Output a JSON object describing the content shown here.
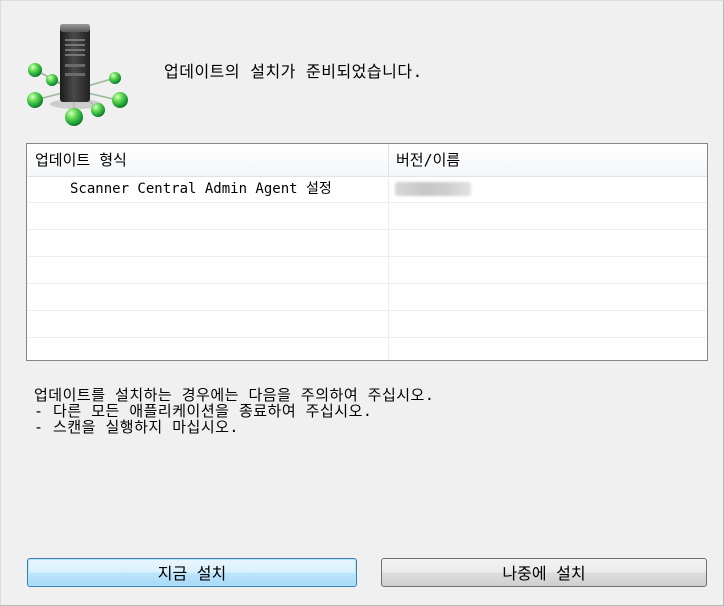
{
  "dialog": {
    "header_text": "업데이트의 설치가 준비되었습니다."
  },
  "update_list": {
    "columns": {
      "type": "업데이트 형식",
      "version": "버전/이름"
    },
    "rows": [
      {
        "type": "Scanner Central Admin Agent 설정",
        "version_redacted": true
      }
    ],
    "empty_rows": 5
  },
  "notice": {
    "lines": [
      "업데이트를 설치하는 경우에는 다음을 주의하여 주십시오.",
      "- 다른 모든 애플리케이션을 종료하여 주십시오.",
      "- 스캔을 실행하지 마십시오."
    ]
  },
  "buttons": {
    "install_now": "지금 설치",
    "install_later": "나중에 설치"
  },
  "colors": {
    "window_bg": "#f0f0f0",
    "icon_green": "#22b34a",
    "server_dark": "#333333",
    "focused_button_border": "#3c7fb1"
  }
}
